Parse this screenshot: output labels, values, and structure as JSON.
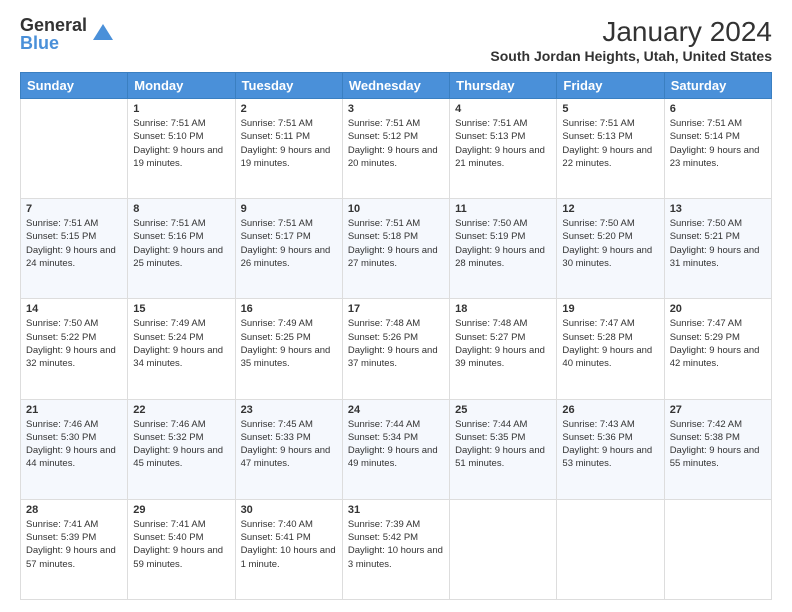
{
  "logo": {
    "general": "General",
    "blue": "Blue"
  },
  "header": {
    "title": "January 2024",
    "location": "South Jordan Heights, Utah, United States"
  },
  "weekdays": [
    "Sunday",
    "Monday",
    "Tuesday",
    "Wednesday",
    "Thursday",
    "Friday",
    "Saturday"
  ],
  "weeks": [
    [
      {
        "day": "",
        "sunrise": "",
        "sunset": "",
        "daylight": ""
      },
      {
        "day": "1",
        "sunrise": "Sunrise: 7:51 AM",
        "sunset": "Sunset: 5:10 PM",
        "daylight": "Daylight: 9 hours and 19 minutes."
      },
      {
        "day": "2",
        "sunrise": "Sunrise: 7:51 AM",
        "sunset": "Sunset: 5:11 PM",
        "daylight": "Daylight: 9 hours and 19 minutes."
      },
      {
        "day": "3",
        "sunrise": "Sunrise: 7:51 AM",
        "sunset": "Sunset: 5:12 PM",
        "daylight": "Daylight: 9 hours and 20 minutes."
      },
      {
        "day": "4",
        "sunrise": "Sunrise: 7:51 AM",
        "sunset": "Sunset: 5:13 PM",
        "daylight": "Daylight: 9 hours and 21 minutes."
      },
      {
        "day": "5",
        "sunrise": "Sunrise: 7:51 AM",
        "sunset": "Sunset: 5:13 PM",
        "daylight": "Daylight: 9 hours and 22 minutes."
      },
      {
        "day": "6",
        "sunrise": "Sunrise: 7:51 AM",
        "sunset": "Sunset: 5:14 PM",
        "daylight": "Daylight: 9 hours and 23 minutes."
      }
    ],
    [
      {
        "day": "7",
        "sunrise": "Sunrise: 7:51 AM",
        "sunset": "Sunset: 5:15 PM",
        "daylight": "Daylight: 9 hours and 24 minutes."
      },
      {
        "day": "8",
        "sunrise": "Sunrise: 7:51 AM",
        "sunset": "Sunset: 5:16 PM",
        "daylight": "Daylight: 9 hours and 25 minutes."
      },
      {
        "day": "9",
        "sunrise": "Sunrise: 7:51 AM",
        "sunset": "Sunset: 5:17 PM",
        "daylight": "Daylight: 9 hours and 26 minutes."
      },
      {
        "day": "10",
        "sunrise": "Sunrise: 7:51 AM",
        "sunset": "Sunset: 5:18 PM",
        "daylight": "Daylight: 9 hours and 27 minutes."
      },
      {
        "day": "11",
        "sunrise": "Sunrise: 7:50 AM",
        "sunset": "Sunset: 5:19 PM",
        "daylight": "Daylight: 9 hours and 28 minutes."
      },
      {
        "day": "12",
        "sunrise": "Sunrise: 7:50 AM",
        "sunset": "Sunset: 5:20 PM",
        "daylight": "Daylight: 9 hours and 30 minutes."
      },
      {
        "day": "13",
        "sunrise": "Sunrise: 7:50 AM",
        "sunset": "Sunset: 5:21 PM",
        "daylight": "Daylight: 9 hours and 31 minutes."
      }
    ],
    [
      {
        "day": "14",
        "sunrise": "Sunrise: 7:50 AM",
        "sunset": "Sunset: 5:22 PM",
        "daylight": "Daylight: 9 hours and 32 minutes."
      },
      {
        "day": "15",
        "sunrise": "Sunrise: 7:49 AM",
        "sunset": "Sunset: 5:24 PM",
        "daylight": "Daylight: 9 hours and 34 minutes."
      },
      {
        "day": "16",
        "sunrise": "Sunrise: 7:49 AM",
        "sunset": "Sunset: 5:25 PM",
        "daylight": "Daylight: 9 hours and 35 minutes."
      },
      {
        "day": "17",
        "sunrise": "Sunrise: 7:48 AM",
        "sunset": "Sunset: 5:26 PM",
        "daylight": "Daylight: 9 hours and 37 minutes."
      },
      {
        "day": "18",
        "sunrise": "Sunrise: 7:48 AM",
        "sunset": "Sunset: 5:27 PM",
        "daylight": "Daylight: 9 hours and 39 minutes."
      },
      {
        "day": "19",
        "sunrise": "Sunrise: 7:47 AM",
        "sunset": "Sunset: 5:28 PM",
        "daylight": "Daylight: 9 hours and 40 minutes."
      },
      {
        "day": "20",
        "sunrise": "Sunrise: 7:47 AM",
        "sunset": "Sunset: 5:29 PM",
        "daylight": "Daylight: 9 hours and 42 minutes."
      }
    ],
    [
      {
        "day": "21",
        "sunrise": "Sunrise: 7:46 AM",
        "sunset": "Sunset: 5:30 PM",
        "daylight": "Daylight: 9 hours and 44 minutes."
      },
      {
        "day": "22",
        "sunrise": "Sunrise: 7:46 AM",
        "sunset": "Sunset: 5:32 PM",
        "daylight": "Daylight: 9 hours and 45 minutes."
      },
      {
        "day": "23",
        "sunrise": "Sunrise: 7:45 AM",
        "sunset": "Sunset: 5:33 PM",
        "daylight": "Daylight: 9 hours and 47 minutes."
      },
      {
        "day": "24",
        "sunrise": "Sunrise: 7:44 AM",
        "sunset": "Sunset: 5:34 PM",
        "daylight": "Daylight: 9 hours and 49 minutes."
      },
      {
        "day": "25",
        "sunrise": "Sunrise: 7:44 AM",
        "sunset": "Sunset: 5:35 PM",
        "daylight": "Daylight: 9 hours and 51 minutes."
      },
      {
        "day": "26",
        "sunrise": "Sunrise: 7:43 AM",
        "sunset": "Sunset: 5:36 PM",
        "daylight": "Daylight: 9 hours and 53 minutes."
      },
      {
        "day": "27",
        "sunrise": "Sunrise: 7:42 AM",
        "sunset": "Sunset: 5:38 PM",
        "daylight": "Daylight: 9 hours and 55 minutes."
      }
    ],
    [
      {
        "day": "28",
        "sunrise": "Sunrise: 7:41 AM",
        "sunset": "Sunset: 5:39 PM",
        "daylight": "Daylight: 9 hours and 57 minutes."
      },
      {
        "day": "29",
        "sunrise": "Sunrise: 7:41 AM",
        "sunset": "Sunset: 5:40 PM",
        "daylight": "Daylight: 9 hours and 59 minutes."
      },
      {
        "day": "30",
        "sunrise": "Sunrise: 7:40 AM",
        "sunset": "Sunset: 5:41 PM",
        "daylight": "Daylight: 10 hours and 1 minute."
      },
      {
        "day": "31",
        "sunrise": "Sunrise: 7:39 AM",
        "sunset": "Sunset: 5:42 PM",
        "daylight": "Daylight: 10 hours and 3 minutes."
      },
      {
        "day": "",
        "sunrise": "",
        "sunset": "",
        "daylight": ""
      },
      {
        "day": "",
        "sunrise": "",
        "sunset": "",
        "daylight": ""
      },
      {
        "day": "",
        "sunrise": "",
        "sunset": "",
        "daylight": ""
      }
    ]
  ]
}
